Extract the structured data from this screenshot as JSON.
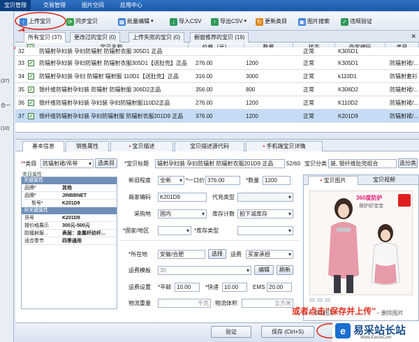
{
  "top_tabs": [
    "宝贝管理",
    "交易管理",
    "图片空间",
    "应用中心"
  ],
  "left_labels": [
    "(37)",
    "合一",
    "(10)"
  ],
  "toolbar": {
    "upload": "上传宝贝",
    "sync": "同步宝贝",
    "batch_edit": "批量编辑",
    "import_csv": "导入CSV",
    "export_csv": "导出CSV",
    "update_category": "更新类目",
    "image_search": "图片搜索",
    "violation_check": "违规验证"
  },
  "product_tabs": [
    "所有宝贝 (37)",
    "更改过的宝贝 (0)",
    "上传失败的宝贝 (0)",
    "橱窗推荐的宝贝 (19)"
  ],
  "grid": {
    "headers": [
      "宝贝名称",
      "价格（元）",
      "数量",
      "状态",
      "商家编码",
      "类目"
    ],
    "rows": [
      {
        "num": "32",
        "name": "防辐射孕妇装 孕妇防辐射 防辐射衣服 305D1 正品",
        "price": "",
        "qty": "",
        "status": "正常",
        "code": "K305D1",
        "cat": ""
      },
      {
        "num": "33",
        "name": "防辐射孕妇装 孕妇防辐射 防辐射衣服305D1【送肚兜】正品",
        "price": "276.00",
        "qty": "1200",
        "status": "正常",
        "code": "K305D1",
        "cat": "防辐射裙/..."
      },
      {
        "num": "34",
        "name": "防辐射孕妇装 孕妇 防辐射 辐射服 110D1【送肚兜】正品",
        "price": "316.00",
        "qty": "3000",
        "status": "正常",
        "code": "k110D1",
        "cat": "防辐射套衫"
      },
      {
        "num": "35",
        "name": "银纤维防辐射孕妇装 防辐射 防辐射服 306D2正品",
        "price": "356.00",
        "qty": "800",
        "status": "正常",
        "code": "K306D2",
        "cat": "防辐射裙/..."
      },
      {
        "num": "36",
        "name": "银纤维防辐射孕妇装 孕妇装 孕妇防辐射服110D2正品",
        "price": "276.00",
        "qty": "1200",
        "status": "正常",
        "code": "K110D2",
        "cat": "防辐射裙/..."
      },
      {
        "num": "37",
        "name": "银纤维防辐射孕妇装 孕妇防辐射服 防辐射衣服201D9 正品",
        "price": "376.00",
        "qty": "1200",
        "status": "正常",
        "code": "K201D9",
        "cat": "防辐射裙/..."
      }
    ]
  },
  "detail_tabs": [
    "基本信息",
    "销售属性",
    "宝贝描述",
    "宝贝描述源代码",
    "手机端宝贝详情"
  ],
  "basic": {
    "category_label": "*类目",
    "category_value": "防辐射裙/吊带",
    "select_category": "选类目",
    "props_title": "类目属性",
    "key_props": "关键属性",
    "brand_k": "品牌*",
    "brand_v": "其他",
    "brand2_k": "品牌*",
    "brand2_v": "JINBBNET",
    "model_k": "型号*",
    "model_v": "K201D9",
    "nonkey_props": "非关键属性",
    "goods_k": "货号",
    "goods_v": "K201D9",
    "price_range_k": "按价格展示",
    "price_range_v": "300元-500元",
    "fabric_k": "防辐射服...",
    "fabric_v": "表层：金属纤纺纤...",
    "season_k": "适合季节",
    "season_v": "四季通用"
  },
  "form": {
    "title_label": "*宝贝标题",
    "title_value": "辐射孕妇装 孕妇防辐射 防辐射衣服201D9 正品",
    "title_count": "52/60",
    "condition_label": "新旧程度",
    "condition_value": "全新",
    "price_label": "*一口价",
    "price_value": "376.00",
    "qty_label": "*数量",
    "qty_value": "1200",
    "code_label": "商家编码",
    "code_value": "K201D9",
    "pay_type_label": "代充类型",
    "origin_label": "采购地",
    "origin_value": "国内",
    "stock_label": "库存计数",
    "stock_value": "拍下减库存",
    "country_label": "*国家/地区",
    "stock_type_label": "*库存类型",
    "location_label": "*所在地",
    "location_value": "安徽/合肥",
    "choose_btn": "选择",
    "freight_label": "运费",
    "freight_value": "买家承担",
    "template_label": "运费模板",
    "template_value": "30",
    "edit_btn": "编辑",
    "refresh_btn": "刷新",
    "fee_label": "运费设置",
    "mail_label": "*平邮",
    "mail_value": "10.00",
    "express_label": "*快递",
    "express_value": "10.00",
    "ems_label": "EMS",
    "ems_value": "20.00",
    "weight_label": "物流重量",
    "weight_unit": "千克",
    "volume_label": "物流体积",
    "volume_unit": "立方米"
  },
  "image_panel": {
    "category_label": "宝贝分类",
    "category_value": "装, 银纤维肚兜组合",
    "select_category_btn": "选分类",
    "tab_images": "宝贝图片",
    "tab_video": "宝贝视频",
    "badge_text": "360度防护",
    "sale_text": "保护好宝宝",
    "add_image": "+ 添加图片",
    "delete_image": "− 删除图片"
  },
  "bottom": {
    "verify_btn": "验证",
    "save_btn": "保存 (Ctrl+S)"
  },
  "annotation": "或者点击\"保存并上传\"",
  "watermark": "易采站长站",
  "watermark_url": "Www.EasckCom"
}
